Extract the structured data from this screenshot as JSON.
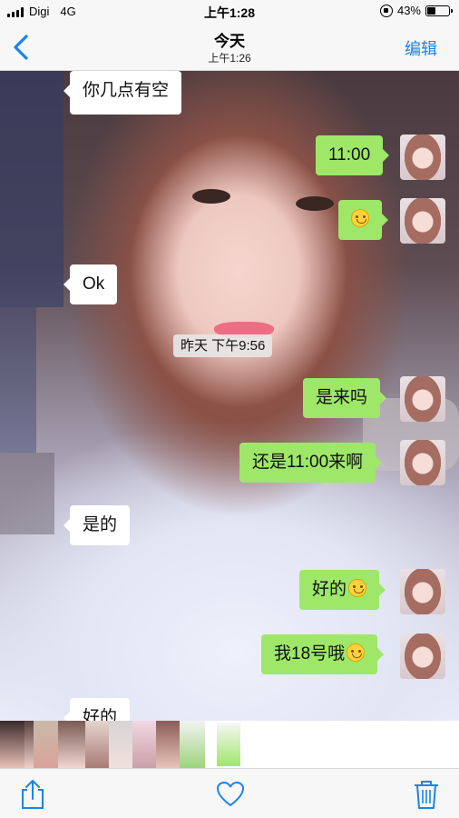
{
  "status_bar": {
    "carrier": "Digi",
    "network": "4G",
    "time": "上午1:28",
    "battery_percent": "43%",
    "battery_level": 0.43
  },
  "nav": {
    "title": "今天",
    "subtitle": "上午1:26",
    "edit_label": "编辑",
    "back_icon": "chevron-left-icon"
  },
  "chat": {
    "messages": [
      {
        "side": "in",
        "text": "你几点有空"
      },
      {
        "side": "out",
        "text": "11:00"
      },
      {
        "side": "out",
        "text": "",
        "emoji": "smiley"
      },
      {
        "side": "in",
        "text": "Ok"
      },
      {
        "side": "out",
        "text": "是来吗"
      },
      {
        "side": "out",
        "text": "还是11:00来啊"
      },
      {
        "side": "in",
        "text": "是的"
      },
      {
        "side": "out",
        "text": "好的",
        "emoji": "smiley"
      },
      {
        "side": "out",
        "text": "我18号哦",
        "emoji": "smiley"
      },
      {
        "side": "in",
        "text": "好的"
      }
    ],
    "timestamp": "昨天 下午9:56"
  },
  "toolbar": {
    "share_icon": "share-icon",
    "favorite_icon": "heart-icon",
    "delete_icon": "trash-icon"
  },
  "colors": {
    "accent": "#1a84e8",
    "out_bubble": "#9ee769",
    "in_bubble": "#ffffff"
  }
}
